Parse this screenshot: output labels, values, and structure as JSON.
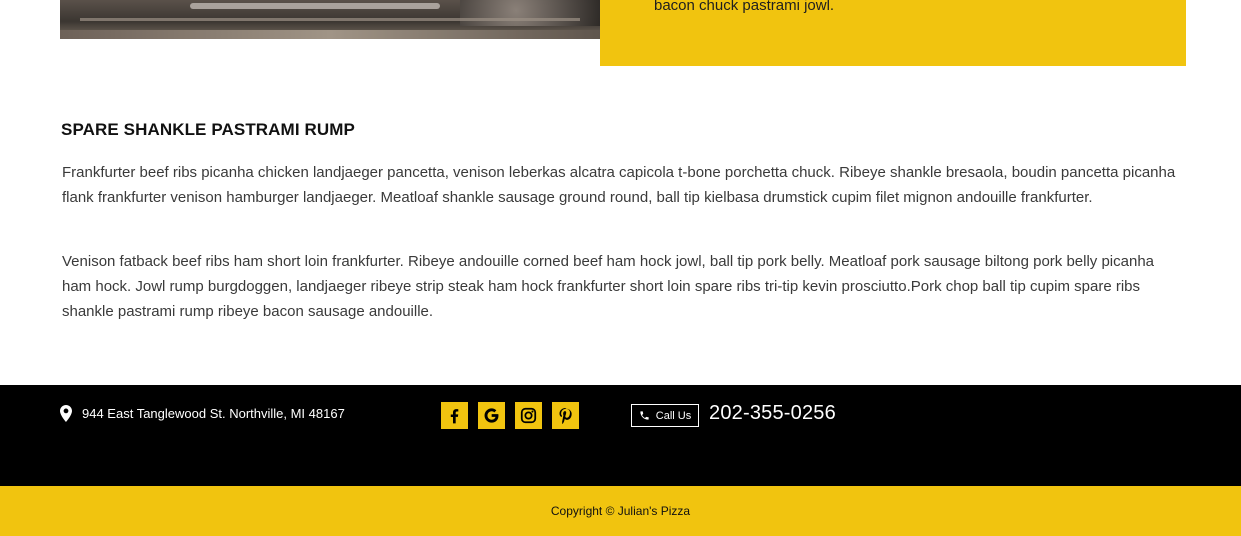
{
  "promo": {
    "text": "bacon chuck pastrami jowl."
  },
  "article": {
    "title": "SPARE SHANKLE PASTRAMI RUMP",
    "paragraphs": [
      "Frankfurter beef ribs picanha chicken landjaeger pancetta, venison leberkas alcatra capicola t-bone porchetta chuck. Ribeye shankle bresaola, boudin pancetta picanha flank frankfurter venison hamburger landjaeger. Meatloaf shankle sausage ground round, ball tip kielbasa drumstick cupim filet mignon andouille frankfurter.",
      "Venison fatback beef ribs ham short loin frankfurter. Ribeye andouille corned beef ham hock jowl, ball tip pork belly. Meatloaf pork sausage biltong pork belly picanha ham hock. Jowl rump burgdoggen, landjaeger ribeye strip steak ham hock frankfurter short loin spare ribs tri-tip kevin prosciutto.Pork chop ball tip cupim spare ribs shankle pastrami rump ribeye bacon sausage andouille."
    ]
  },
  "footer": {
    "address": "944 East Tanglewood St. Northville, MI 48167",
    "address_icon": "map-pin-icon",
    "social_icons": [
      "facebook-icon",
      "google-icon",
      "instagram-icon",
      "pinterest-icon"
    ],
    "call_label": "Call Us",
    "call_icon": "phone-icon",
    "phone": "202-355-0256",
    "copyright": "Copyright © Julian's Pizza"
  },
  "colors": {
    "accent": "#f1c40f",
    "footer_bg": "#000000",
    "body_text": "#3a3a3a"
  }
}
